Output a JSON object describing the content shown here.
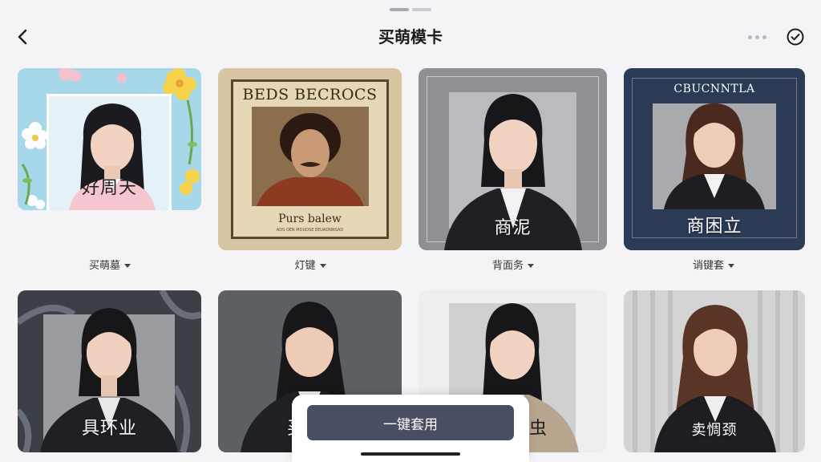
{
  "header": {
    "title": "买萌模卡"
  },
  "templates_row1": [
    {
      "label": "好周天",
      "dropdown": "买萌墓"
    },
    {
      "poster_title": "BEDS BECROCS",
      "poster_caption": "Purs balew",
      "poster_small": "ADS OEN MOUDSE EEUADNNSAD",
      "dropdown": "灯键"
    },
    {
      "label": "商泥",
      "dropdown": "背面务"
    },
    {
      "frame_title": "CBUCNNTLA",
      "label": "商困立",
      "dropdown": "诮键套"
    }
  ],
  "templates_row2": [
    {
      "label": "具环业"
    },
    {
      "label": "买"
    },
    {
      "label": "虫"
    },
    {
      "label": "卖惆颈"
    }
  ],
  "bottom": {
    "apply_label": "一键套用"
  },
  "colors": {
    "apply_button": "#4a4e63",
    "navy_frame": "#2b3a55",
    "sky_bg": "#a7d8ea"
  }
}
